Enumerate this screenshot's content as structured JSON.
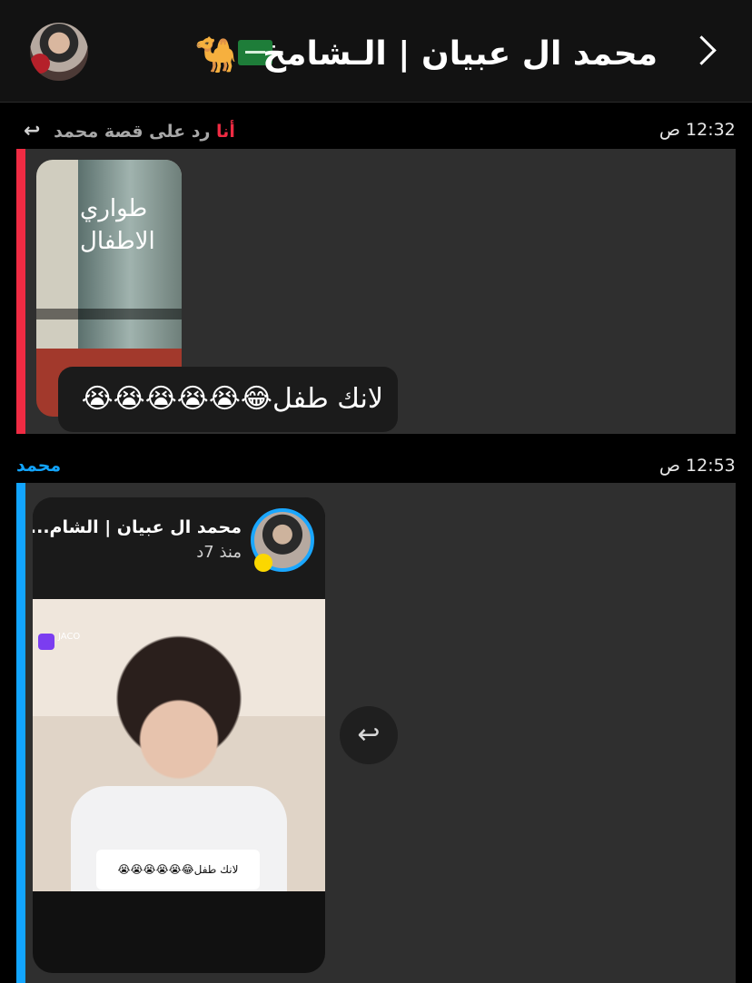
{
  "header": {
    "title": "محمد ال عبيان | الـشامخ",
    "flag_icon": "saudi-flag",
    "camel_icon": "camel-emoji"
  },
  "messages": [
    {
      "time": "12:32 ص",
      "reply_context": "رد على قصة محمد",
      "reply_by": "أنا",
      "story_thumb_text": "طواري الاطفال",
      "text": "لانك طفل",
      "emojis": "😂😭😭😭😭😭"
    },
    {
      "time": "12:53 ص",
      "sender": "محمد",
      "story_name": "محمد ال عبيان | الشام...",
      "story_time": "منذ 7د",
      "sticker_text": "لانك طفل😂😭😭😭😭😭",
      "logo_text": "JACO"
    }
  ]
}
